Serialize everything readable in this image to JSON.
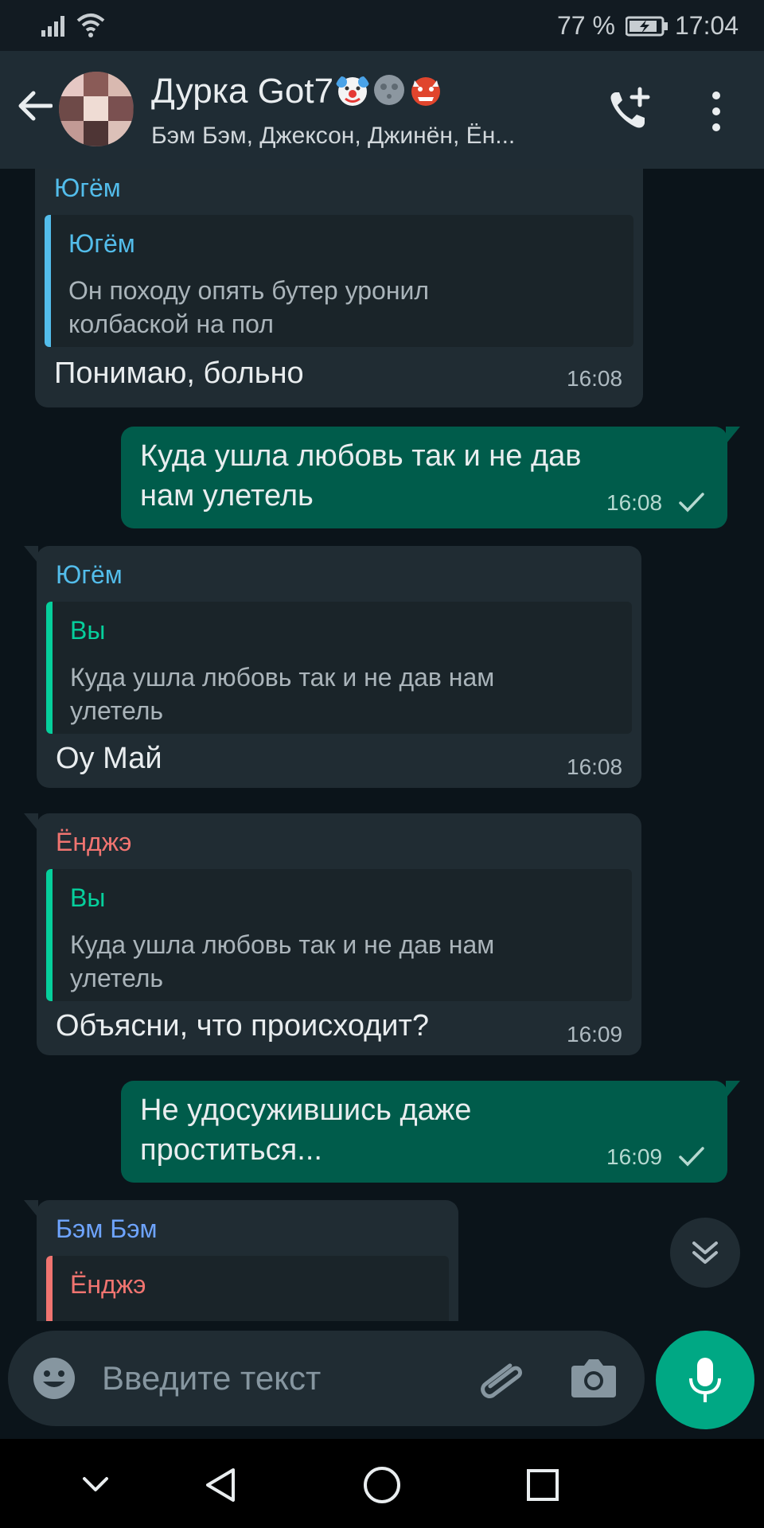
{
  "status_bar": {
    "battery_percent": "77 %",
    "time": "17:04"
  },
  "header": {
    "title": "Дурка Got7",
    "title_emojis": [
      "clown-face-emoji",
      "new-moon-face-emoji",
      "ogre-emoji"
    ],
    "subtitle": "Бэм Бэм, Джексон, Джинён, Ён..."
  },
  "colors": {
    "sender_yugyeom": "#53bdeb",
    "sender_youngjae": "#f07470",
    "sender_bambam": "#6ea4ff",
    "quote_self": "#06cf9c",
    "outgoing_bubble": "#005c4b",
    "incoming_bubble": "#202c33",
    "accent": "#00a884"
  },
  "messages": [
    {
      "direction": "in",
      "sender": "Югём",
      "quote_author": "Югём",
      "quote_lines": [
        "Он походу опять бутер уронил",
        "колбаской на пол"
      ],
      "text_lines": [
        "Понимаю,  больно"
      ],
      "time": "16:08"
    },
    {
      "direction": "out",
      "text_lines": [
        "Куда ушла любовь так и не дав",
        "нам улетель"
      ],
      "time": "16:08",
      "status": "sent-check"
    },
    {
      "direction": "in",
      "sender": "Югём",
      "quote_author": "Вы",
      "quote_lines": [
        "Куда ушла любовь так и не дав нам",
        "улетель"
      ],
      "text_lines": [
        "Оу Май"
      ],
      "time": "16:08"
    },
    {
      "direction": "in",
      "sender": "Ёнджэ",
      "quote_author": "Вы",
      "quote_lines": [
        "Куда ушла любовь так и не дав нам",
        "улетель"
      ],
      "text_lines": [
        "Объясни, что происходит?"
      ],
      "time": "16:09"
    },
    {
      "direction": "out",
      "text_lines": [
        "Не удосужившись даже",
        "проститься..."
      ],
      "time": "16:09",
      "status": "sent-check"
    },
    {
      "direction": "in",
      "sender": "Бэм Бэм",
      "quote_author": "Ёнджэ",
      "quote_lines": [],
      "text_lines": [],
      "time": ""
    }
  ],
  "composer": {
    "placeholder": "Введите текст"
  }
}
